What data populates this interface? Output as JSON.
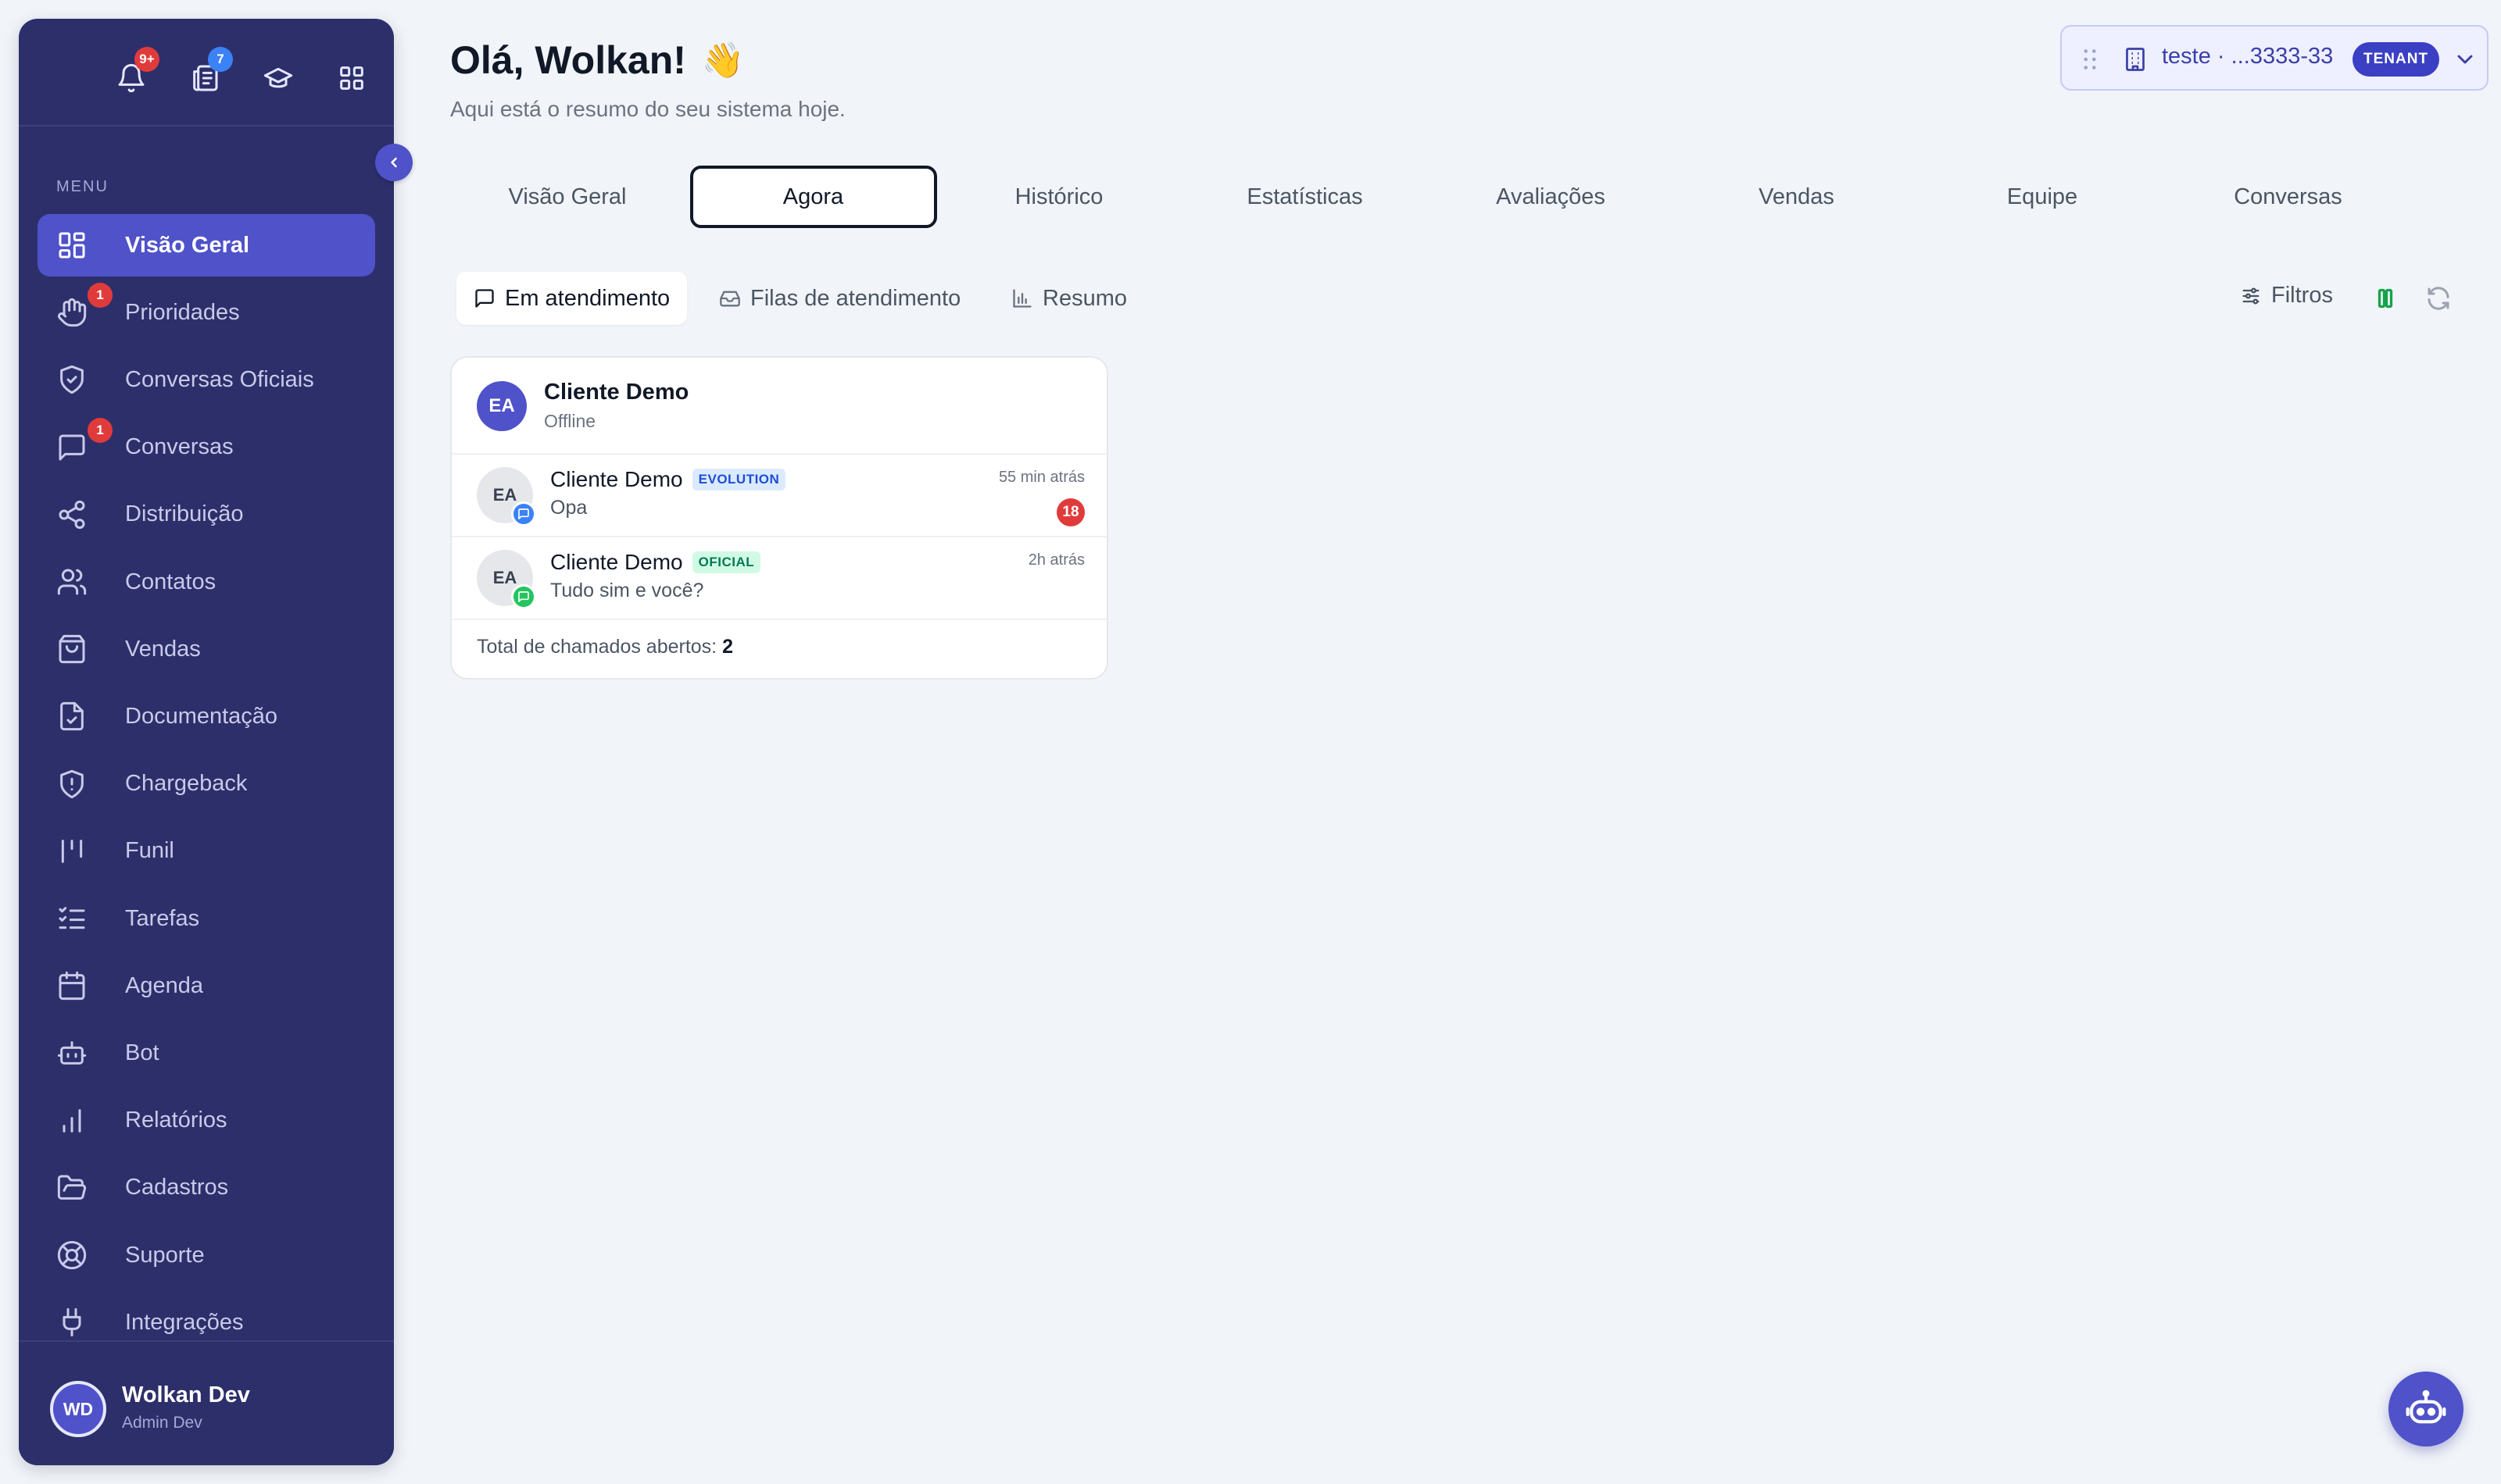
{
  "sidebar": {
    "top_badges": {
      "notifications": "9+",
      "tickets": "7"
    },
    "menu_label": "MENU",
    "items": [
      {
        "label": "Visão Geral",
        "icon": "dashboard-grid-icon",
        "active": true,
        "badge": ""
      },
      {
        "label": "Prioridades",
        "icon": "hand-icon",
        "active": false,
        "badge": "1"
      },
      {
        "label": "Conversas Oficiais",
        "icon": "shield-check-icon",
        "active": false,
        "badge": ""
      },
      {
        "label": "Conversas",
        "icon": "chat-icon",
        "active": false,
        "badge": "1"
      },
      {
        "label": "Distribuição",
        "icon": "share-icon",
        "active": false,
        "badge": ""
      },
      {
        "label": "Contatos",
        "icon": "users-icon",
        "active": false,
        "badge": ""
      },
      {
        "label": "Vendas",
        "icon": "shopping-bag-icon",
        "active": false,
        "badge": ""
      },
      {
        "label": "Documentação",
        "icon": "document-icon",
        "active": false,
        "badge": ""
      },
      {
        "label": "Chargeback",
        "icon": "shield-alert-icon",
        "active": false,
        "badge": ""
      },
      {
        "label": "Funil",
        "icon": "funnel-icon",
        "active": false,
        "badge": ""
      },
      {
        "label": "Tarefas",
        "icon": "task-list-icon",
        "active": false,
        "badge": ""
      },
      {
        "label": "Agenda",
        "icon": "calendar-icon",
        "active": false,
        "badge": ""
      },
      {
        "label": "Bot",
        "icon": "bot-icon",
        "active": false,
        "badge": ""
      },
      {
        "label": "Relatórios",
        "icon": "bar-chart-icon",
        "active": false,
        "badge": ""
      },
      {
        "label": "Cadastros",
        "icon": "folder-icon",
        "active": false,
        "badge": ""
      },
      {
        "label": "Suporte",
        "icon": "lifebuoy-icon",
        "active": false,
        "badge": ""
      },
      {
        "label": "Integrações",
        "icon": "plug-icon",
        "active": false,
        "badge": ""
      }
    ],
    "user": {
      "initials": "WD",
      "name": "Wolkan Dev",
      "role": "Admin Dev"
    }
  },
  "header": {
    "greeting": "Olá, Wolkan!",
    "greeting_emoji": "👋",
    "subtitle": "Aqui está o resumo do seu sistema hoje."
  },
  "tenant": {
    "name": "teste · ...3333-33",
    "badge": "TENANT"
  },
  "tabs": [
    {
      "label": "Visão Geral",
      "active": false
    },
    {
      "label": "Agora",
      "active": true
    },
    {
      "label": "Histórico",
      "active": false
    },
    {
      "label": "Estatísticas",
      "active": false
    },
    {
      "label": "Avaliações",
      "active": false
    },
    {
      "label": "Vendas",
      "active": false
    },
    {
      "label": "Equipe",
      "active": false
    },
    {
      "label": "Conversas",
      "active": false
    }
  ],
  "subtabs": [
    {
      "label": "Em atendimento",
      "active": true
    },
    {
      "label": "Filas de atendimento",
      "active": false
    },
    {
      "label": "Resumo",
      "active": false
    }
  ],
  "toolbar": {
    "filters_label": "Filtros"
  },
  "card": {
    "initials": "EA",
    "name": "Cliente Demo",
    "status": "Offline",
    "conversations": [
      {
        "initials": "EA",
        "name": "Cliente Demo",
        "tag": "EVOLUTION",
        "message": "Opa",
        "time": "55 min atrás",
        "unread": "18",
        "channel_color": "#3b82f6"
      },
      {
        "initials": "EA",
        "name": "Cliente Demo",
        "tag": "OFICIAL",
        "message": "Tudo sim e você?",
        "time": "2h atrás",
        "unread": "",
        "channel_color": "#22c55e"
      }
    ],
    "total_label": "Total de chamados abertos:",
    "total_value": "2"
  },
  "colors": {
    "sidebar_bg": "#2d2f6b",
    "accent": "#4f52c9",
    "badge_red": "#e03b3b",
    "badge_blue": "#3b82f6"
  }
}
